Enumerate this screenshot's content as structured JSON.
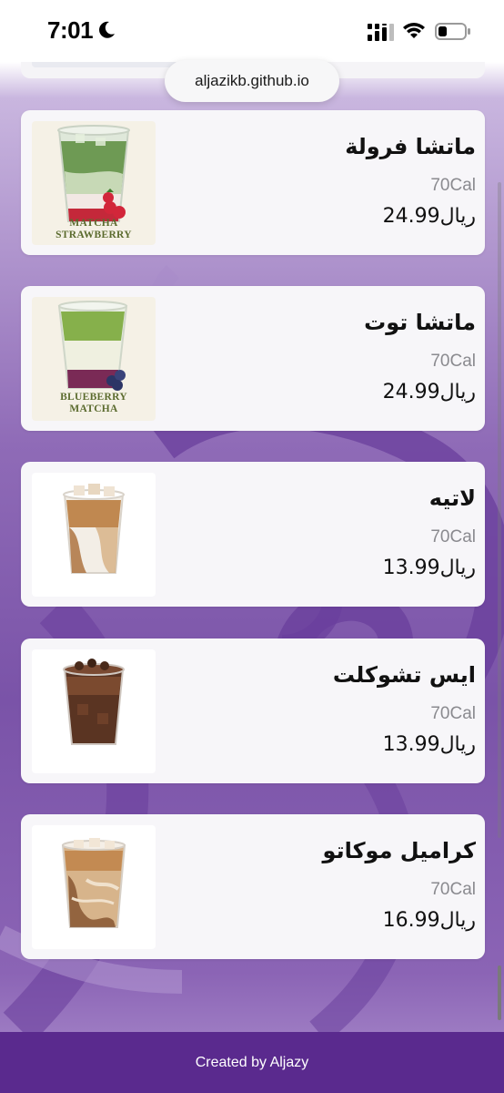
{
  "status_bar": {
    "time": "7:01"
  },
  "browser": {
    "url": "aljazikb.github.io"
  },
  "menu_items": [
    {
      "name": "ماتشا فرولة",
      "calories": "70Cal",
      "price": "ريال24.99",
      "image_label": [
        "MATCHA",
        "STRAWBERRY"
      ],
      "image": "matcha-strawberry"
    },
    {
      "name": "ماتشا توت",
      "calories": "70Cal",
      "price": "ريال24.99",
      "image_label": [
        "BLUEBERRY",
        "MATCHA"
      ],
      "image": "blueberry-matcha"
    },
    {
      "name": "لاتيه",
      "calories": "70Cal",
      "price": "ريال13.99",
      "image": "iced-latte"
    },
    {
      "name": "ايس تشوكلت",
      "calories": "70Cal",
      "price": "ريال13.99",
      "image": "iced-chocolate"
    },
    {
      "name": "كراميل موكاتو",
      "calories": "70Cal",
      "price": "ريال16.99",
      "image": "caramel-mochato"
    }
  ],
  "footer": {
    "text": "Created by Aljazy"
  },
  "colors": {
    "accent": "#5a2a8e",
    "background": "#8f6bb7",
    "card": "#f7f6f9"
  }
}
